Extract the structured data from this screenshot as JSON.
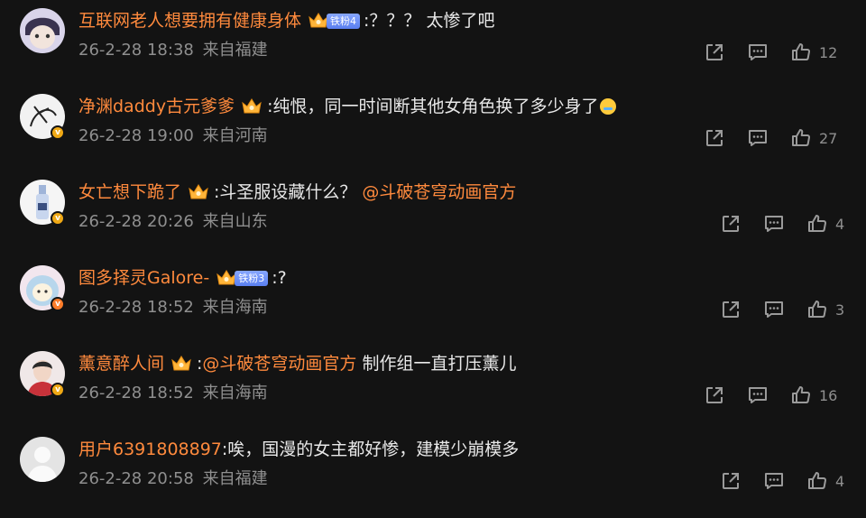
{
  "comments": [
    {
      "username": "互联网老人想要拥有健康身体",
      "fan_badge": "铁粉4",
      "text": ":？？？ 太惨了吧",
      "mention": "",
      "text_after": "",
      "date": "26-2-28 18:38",
      "location": "来自福建",
      "likes": "12"
    },
    {
      "username": "净渊daddy古元爹爹",
      "fan_badge": "",
      "text": ":纯恨，同一时间断其他女角色换了多少身了",
      "mention": "",
      "text_after": "",
      "date": "26-2-28 19:00",
      "location": "来自河南",
      "likes": "27"
    },
    {
      "username": "女亡想下跪了",
      "fan_badge": "",
      "text": ":斗圣服设藏什么？",
      "mention": "@斗破苍穹动画官方",
      "text_after": "",
      "date": "26-2-28 20:26",
      "location": "来自山东",
      "likes": "4"
    },
    {
      "username": "图多择灵Galore-",
      "fan_badge": "铁粉3",
      "text": ":?",
      "mention": "",
      "text_after": "",
      "date": "26-2-28 18:52",
      "location": "来自海南",
      "likes": "3"
    },
    {
      "username": "薰意醉人间",
      "fan_badge": "",
      "text": ":",
      "mention": "@斗破苍穹动画官方",
      "text_after": " 制作组一直打压薰儿",
      "date": "26-2-28 18:52",
      "location": "来自海南",
      "likes": "16"
    },
    {
      "username": "用户6391808897",
      "fan_badge": "",
      "text": ":唉，国漫的女主都好惨，建模少崩模多",
      "mention": "",
      "text_after": "",
      "date": "26-2-28 20:58",
      "location": "来自福建",
      "likes": "4"
    }
  ],
  "colors": {
    "background": "#131313",
    "username": "#ff8a3d",
    "meta": "#8f8f8f",
    "verified_badge": "#f0a915",
    "fan_badge": "#6b8ff5"
  },
  "icons": {
    "share": "share-icon",
    "comment": "comment-icon",
    "like": "like-icon",
    "crown": "crown-icon",
    "verified": "verified-badge-icon"
  }
}
